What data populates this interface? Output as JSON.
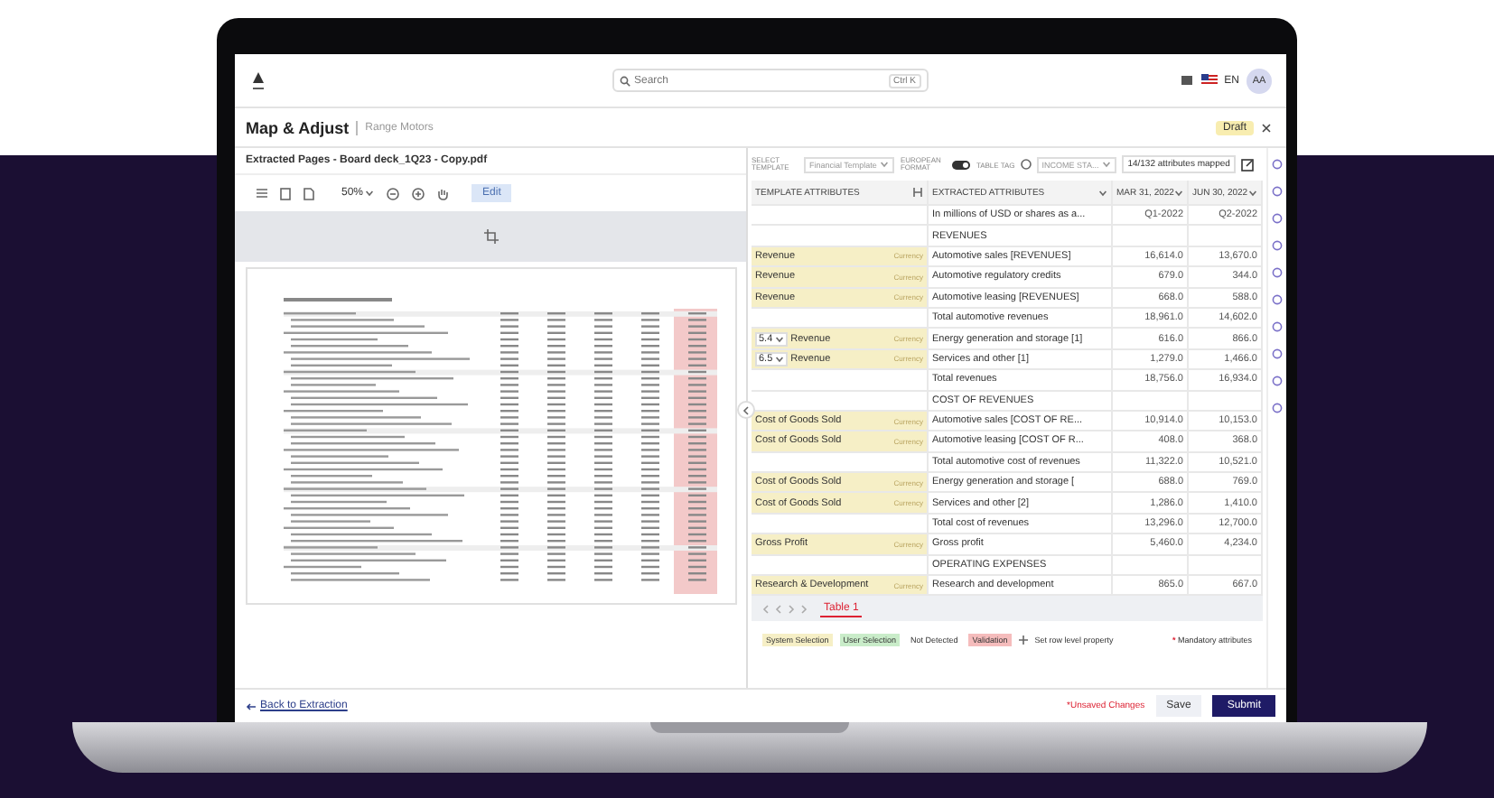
{
  "header": {
    "search_placeholder": "Search",
    "shortcut": "Ctrl K",
    "language": "EN",
    "avatar": "AA"
  },
  "page": {
    "title": "Map & Adjust",
    "subtitle": "Range Motors",
    "status": "Draft"
  },
  "left": {
    "file_title": "Extracted Pages - Board deck_1Q23 - Copy.pdf",
    "zoom": "50%",
    "edit": "Edit"
  },
  "right": {
    "select_template_label": "SELECT TEMPLATE",
    "template": "Financial Template",
    "european_format_label": "EUROPEAN FORMAT",
    "european_format_on": true,
    "table_tag_label": "TABLE TAG",
    "table_tag": "INCOME STA...",
    "mapped": "14/132 attributes mapped",
    "columns": [
      "TEMPLATE ATTRIBUTES",
      "EXTRACTED ATTRIBUTES",
      "MAR 31, 2022",
      "JUN 30, 2022"
    ],
    "rows": [
      {
        "kind": "unmapped",
        "extracted": "In millions of USD or shares as a...",
        "values": [
          "Q1-2022",
          "Q2-2022"
        ]
      },
      {
        "kind": "unmapped",
        "extracted": "REVENUES",
        "values": []
      },
      {
        "kind": "mapped",
        "template": "Revenue",
        "tag": "Currency",
        "extracted": "Automotive sales [REVENUES]",
        "values": [
          "16,614.0",
          "13,670.0"
        ]
      },
      {
        "kind": "mapped",
        "template": "Revenue",
        "tag": "Currency",
        "extracted": "Automotive regulatory credits",
        "values": [
          "679.0",
          "344.0"
        ]
      },
      {
        "kind": "mapped",
        "template": "Revenue",
        "tag": "Currency",
        "extracted": "Automotive leasing [REVENUES]",
        "values": [
          "668.0",
          "588.0"
        ]
      },
      {
        "kind": "unmapped",
        "extracted": "Total automotive revenues",
        "values": [
          "18,961.0",
          "14,602.0"
        ]
      },
      {
        "kind": "mapped",
        "prefix": "5.4",
        "template": "Revenue",
        "tag": "Currency",
        "extracted": "Energy generation and storage [1]",
        "values": [
          "616.0",
          "866.0"
        ]
      },
      {
        "kind": "mapped",
        "prefix": "6.5",
        "template": "Revenue",
        "tag": "Currency",
        "extracted": "Services and other [1]",
        "values": [
          "1,279.0",
          "1,466.0"
        ]
      },
      {
        "kind": "unmapped",
        "extracted": "Total revenues",
        "values": [
          "18,756.0",
          "16,934.0"
        ]
      },
      {
        "kind": "unmapped",
        "extracted": "COST OF REVENUES",
        "values": []
      },
      {
        "kind": "mapped",
        "template": "Cost of Goods Sold",
        "tag": "Currency",
        "extracted": "Automotive sales [COST OF RE...",
        "values": [
          "10,914.0",
          "10,153.0"
        ]
      },
      {
        "kind": "mapped",
        "template": "Cost of Goods Sold",
        "tag": "Currency",
        "extracted": "Automotive leasing [COST OF R...",
        "values": [
          "408.0",
          "368.0"
        ]
      },
      {
        "kind": "unmapped",
        "extracted": "Total automotive cost of revenues",
        "values": [
          "11,322.0",
          "10,521.0"
        ]
      },
      {
        "kind": "mapped",
        "template": "Cost of Goods Sold",
        "tag": "Currency",
        "extracted": "Energy generation and storage [",
        "values": [
          "688.0",
          "769.0"
        ]
      },
      {
        "kind": "mapped",
        "template": "Cost of Goods Sold",
        "tag": "Currency",
        "extracted": "Services and other [2]",
        "values": [
          "1,286.0",
          "1,410.0"
        ]
      },
      {
        "kind": "unmapped",
        "extracted": "Total cost of revenues",
        "values": [
          "13,296.0",
          "12,700.0"
        ]
      },
      {
        "kind": "mapped",
        "template": "Gross Profit",
        "tag": "Currency",
        "extracted": "Gross profit",
        "values": [
          "5,460.0",
          "4,234.0"
        ]
      },
      {
        "kind": "unmapped",
        "extracted": "OPERATING EXPENSES",
        "values": []
      },
      {
        "kind": "mapped",
        "template": "Research & Development",
        "tag": "Currency",
        "extracted": "Research and development",
        "values": [
          "865.0",
          "667.0"
        ]
      }
    ],
    "sheet_tab": "Table 1",
    "legend": [
      {
        "label": "System Selection",
        "color": "#f6efc6"
      },
      {
        "label": "User Selection",
        "color": "#c9ecc9"
      },
      {
        "label": "Not Detected",
        "color": "#ffffff"
      },
      {
        "label": "Validation",
        "color": "#f5bcbc"
      }
    ],
    "legend_note": "Set row level property",
    "mandatory": "* Mandatory attributes"
  },
  "footer": {
    "back": "Back to Extraction",
    "unsaved": "*Unsaved Changes",
    "save": "Save",
    "submit": "Submit"
  }
}
